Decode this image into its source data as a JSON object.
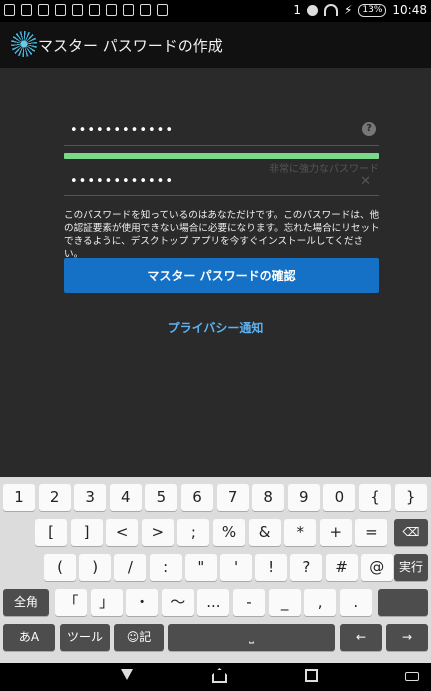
{
  "status_bar": {
    "signal": "1",
    "battery": "13%",
    "time": "10:48"
  },
  "app_bar": {
    "title": "マスター パスワードの作成"
  },
  "form": {
    "password_value": "••••••••••••",
    "strength_label": "非常に強力なパスワード",
    "confirm_value": "••••••••••••",
    "help_glyph": "?",
    "clear_glyph": "✕",
    "info_text": "このパスワードを知っているのはあなただけです。このパスワードは、他の認証要素が使用できない場合に必要になります。忘れた場合にリセットできるように、デスクトップ アプリを今すぐインストールしてください。",
    "confirm_button": "マスター パスワードの確認",
    "privacy_link": "プライバシー通知",
    "strength_fraction": 1.0
  },
  "keyboard": {
    "row1": [
      "1",
      "2",
      "3",
      "4",
      "5",
      "6",
      "7",
      "8",
      "9",
      "0",
      "{",
      "}"
    ],
    "row2": [
      "[",
      "]",
      "<",
      ">",
      ";",
      "%",
      "&",
      "*",
      "+",
      "="
    ],
    "row2_backspace": "⌫",
    "row3": [
      "(",
      ")",
      "/",
      ":",
      "\"",
      "'",
      "!",
      "?",
      "#",
      "@"
    ],
    "row3_enter": "実行",
    "row4_mode": "全角",
    "row4": [
      "「",
      "」",
      "・",
      "〜",
      "...",
      "-",
      "_",
      ",",
      "."
    ],
    "row5_lang": "あA",
    "row5_tools": "ツール",
    "row5_emoji": "☺記",
    "row5_space": "⎵",
    "row5_left": "←",
    "row5_right": "→"
  }
}
